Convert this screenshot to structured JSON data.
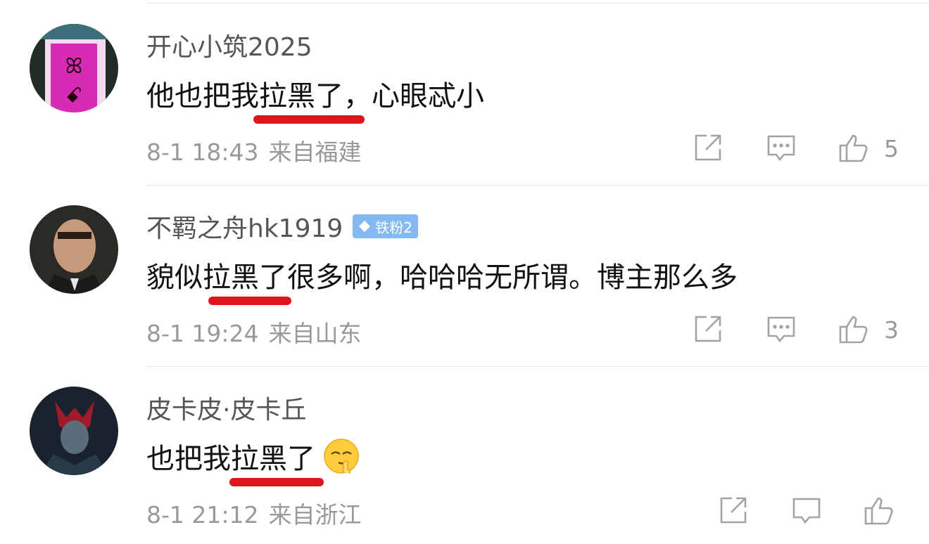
{
  "comments": [
    {
      "username": "开心小筑2025",
      "text": "他也把我拉黑了，心眼忒小",
      "date": "8-1 18:43",
      "location": "来自福建",
      "likes": "5"
    },
    {
      "username": "不羁之舟hk1919",
      "badge": "铁粉2",
      "text": "貌似拉黑了很多啊，哈哈哈无所谓。博主那么多",
      "date": "8-1 19:24",
      "location": "来自山东",
      "likes": "3"
    },
    {
      "username": "皮卡皮·皮卡丘",
      "text": "也把我拉黑了",
      "date": "8-1 21:12",
      "location": "来自浙江"
    }
  ],
  "colors": {
    "accent_red": "#e0141e",
    "badge_blue": "#86b8f2",
    "meta_gray": "#999999"
  },
  "icons": [
    "repost-icon",
    "comment-icon",
    "like-icon",
    "shush-emoji"
  ]
}
